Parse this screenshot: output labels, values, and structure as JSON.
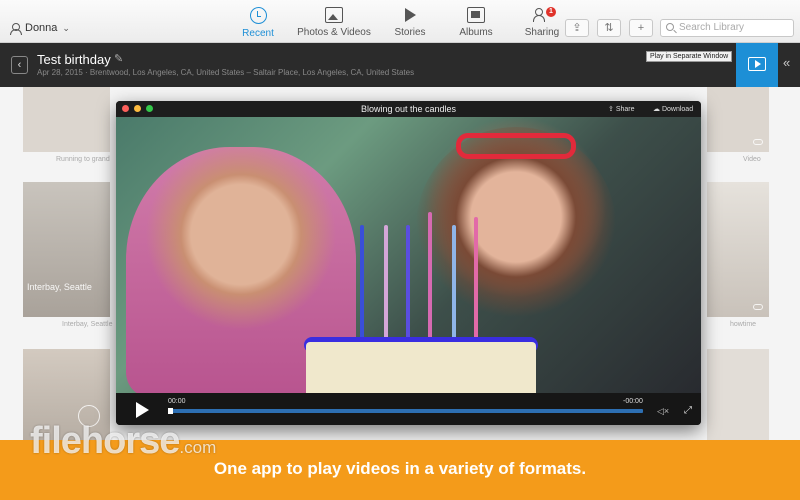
{
  "header": {
    "user_name": "Donna",
    "tabs": [
      {
        "label": "Recent",
        "icon": "clock-icon"
      },
      {
        "label": "Photos & Videos",
        "icon": "photos-icon"
      },
      {
        "label": "Stories",
        "icon": "stories-icon"
      },
      {
        "label": "Albums",
        "icon": "albums-icon"
      },
      {
        "label": "Sharing",
        "icon": "sharing-icon",
        "badge": "1"
      }
    ],
    "active_tab": "Recent",
    "search_placeholder": "Search Library"
  },
  "event": {
    "title": "Test birthday",
    "subtitle": "Apr 28, 2015 · Brentwood, Los Angeles, CA, United States – Saltair Place, Los Angeles, CA, United States",
    "tooltip": "Play in Separate Window"
  },
  "grid": {
    "captions": [
      "Running to grand",
      "Interbay, Seattle",
      "Interbay, Seattle",
      "Video",
      "howtime"
    ]
  },
  "video": {
    "title": "Blowing out the candles",
    "share_label": "Share",
    "download_label": "Download",
    "time_elapsed": "00:00",
    "time_remaining": "-00:00",
    "progress": 0
  },
  "banner": {
    "text": "One app to play videos in a variety of formats.",
    "watermark": "filehorse",
    "watermark_suffix": ".com"
  },
  "colors": {
    "accent": "#1e8fd6",
    "banner": "#f49b1a",
    "badge": "#e0322a"
  }
}
